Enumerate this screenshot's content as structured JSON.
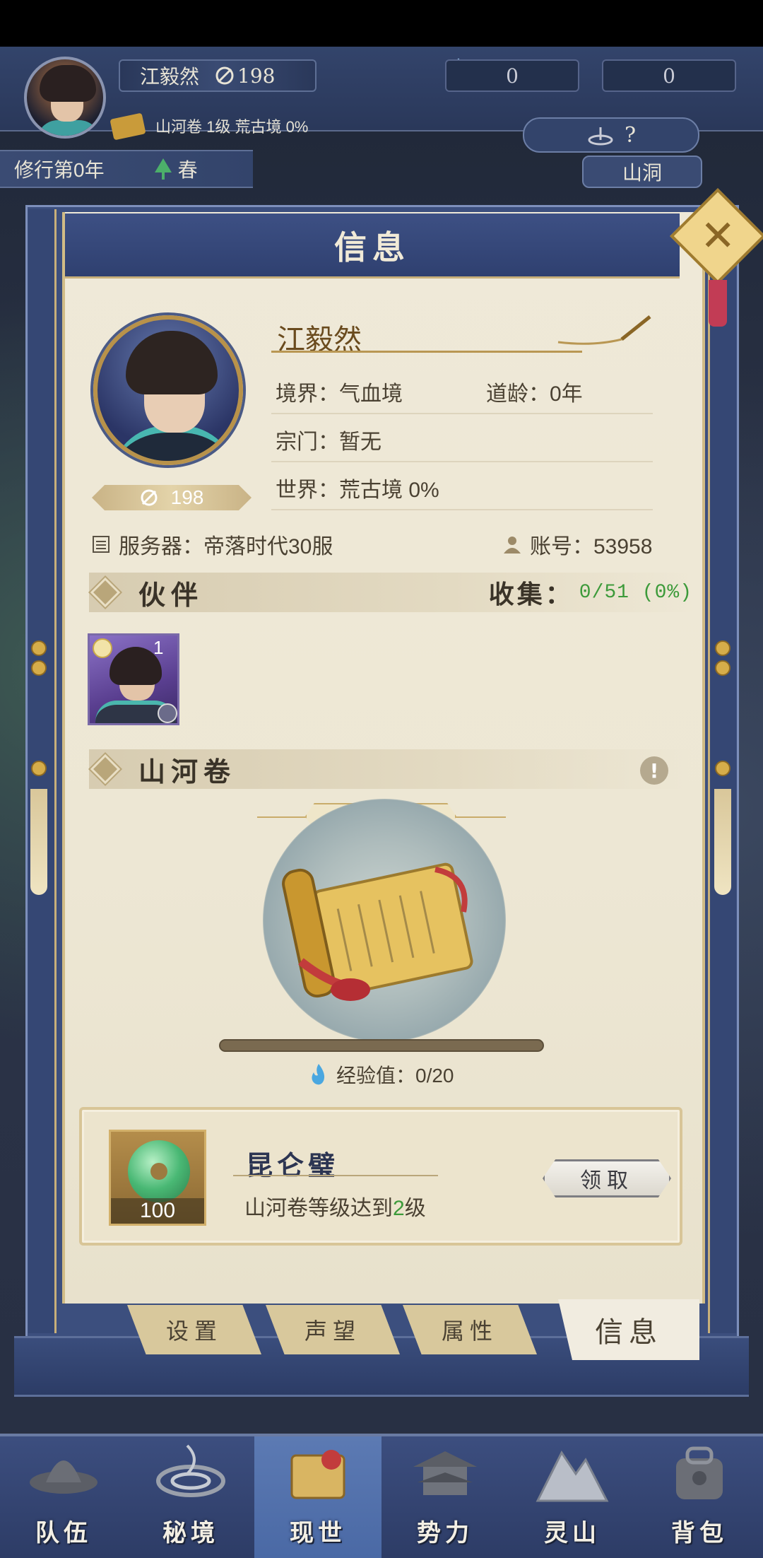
{
  "hud": {
    "player_name": "江毅然",
    "power": "198",
    "currency_crystal": "0",
    "currency_jade": "0",
    "scroll_status": "山河卷 1级 荒古境 0%",
    "year": "修行第0年",
    "season": "春",
    "help": "?",
    "location": "山洞"
  },
  "panel": {
    "title": "信息",
    "close_icon": "close-x-icon"
  },
  "profile": {
    "name": "江毅然",
    "power": "198",
    "realm": "境界：气血境",
    "dao_age": "道龄：0年",
    "sect": "宗门：暂无",
    "world": "世界：荒古境  0%",
    "server": "服务器：帝落时代30服",
    "account": "账号：53958"
  },
  "partners": {
    "title": "伙伴",
    "collect_label": "收集：",
    "collect_value": "0/51 (0%)",
    "cards": [
      {
        "level": "1"
      }
    ]
  },
  "scroll": {
    "title": "山河卷",
    "level": "1级",
    "exp_label": "经验值：0/20",
    "exp_progress": 0
  },
  "reward": {
    "name": "昆仑璧",
    "quantity": "100",
    "desc_prefix": "山河卷等级达到",
    "desc_level": "2",
    "desc_suffix": "级",
    "claim": "领取"
  },
  "tabs": [
    "设置",
    "声望",
    "属性",
    "信息"
  ],
  "nav": [
    "队伍",
    "秘境",
    "现世",
    "势力",
    "灵山",
    "背包"
  ],
  "colors": {
    "frame_blue": "#3c4f7e",
    "paper": "#efe9d8",
    "gold": "#c8b07a",
    "green_value": "#3c9a3a"
  }
}
